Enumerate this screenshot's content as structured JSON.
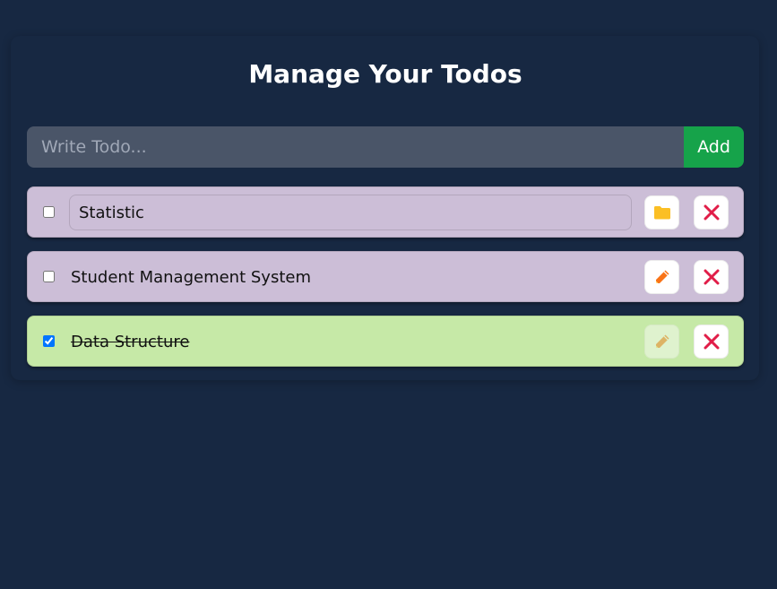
{
  "heading": "Manage Your Todos",
  "add_form": {
    "placeholder": "Write Todo...",
    "value": "",
    "button_label": "Add"
  },
  "todos": [
    {
      "text": "Statistic",
      "completed": false,
      "editing": true,
      "action_icon": "folder-icon"
    },
    {
      "text": "Student Management System",
      "completed": false,
      "editing": false,
      "action_icon": "pencil-icon"
    },
    {
      "text": "Data Structure",
      "completed": true,
      "editing": false,
      "action_icon": "pencil-icon"
    }
  ],
  "colors": {
    "page_background": "#172842",
    "input_background": "#4a5568",
    "add_button": "#16a34a",
    "todo_pending": "#ccbed7",
    "todo_completed": "#c6e9a7",
    "delete_icon": "#e11d48",
    "folder_icon": "#fbbf24",
    "pencil_icon": "#f97316"
  },
  "icons": {
    "delete": "close-icon",
    "save": "folder-icon",
    "edit": "pencil-icon"
  }
}
